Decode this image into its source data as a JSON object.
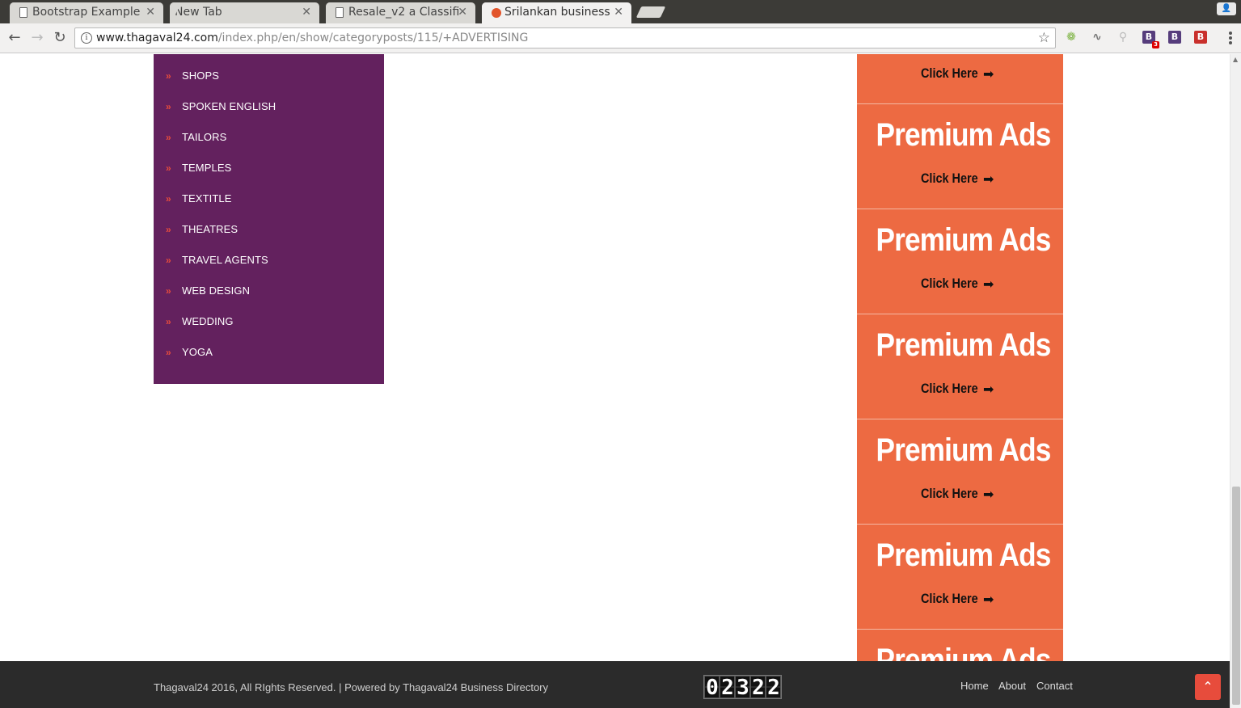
{
  "browser": {
    "tabs": [
      {
        "title": "Bootstrap Example"
      },
      {
        "title": "New Tab"
      },
      {
        "title": "Resale_v2 a Classifi"
      },
      {
        "title": "Srilankan business"
      }
    ],
    "url_host": "www.thagaval24.com",
    "url_path": "/index.php/en/show/categoryposts/115/+ADVERTISING",
    "extensions": [
      {
        "icon": "fruit-extension-icon",
        "glyph": "❁",
        "color": "#7cb342"
      },
      {
        "icon": "wand-extension-icon",
        "glyph": "∿",
        "color": "#777777"
      },
      {
        "icon": "wrench-extension-icon",
        "glyph": "⚲",
        "color": "#bbbbbb"
      },
      {
        "icon": "bootstrap-extension-icon",
        "glyph": "B",
        "color": "#563d7c",
        "badge": "3"
      },
      {
        "icon": "bootstrap-extension-icon",
        "glyph": "B",
        "color": "#563d7c"
      },
      {
        "icon": "brave-extension-icon",
        "glyph": "B",
        "color": "#c9302c"
      }
    ]
  },
  "sidebar": {
    "chevron": "»",
    "categories": [
      "SHOPS",
      "SPOKEN ENGLISH",
      "TAILORS",
      "TEMPLES",
      "TEXTITLE",
      "THEATRES",
      "TRAVEL AGENTS",
      "WEB DESIGN",
      "WEDDING",
      "YOGA"
    ]
  },
  "ads": {
    "title": "Premium Ads",
    "cta": "Click Here",
    "arrow": "➡",
    "count": 7,
    "color": "#ed6a42"
  },
  "footer": {
    "copyright": "Thagaval24 2016, All RIghts Reserved. | Powered by Thagaval24 Business Directory",
    "counter_digits": [
      "0",
      "2",
      "3",
      "2",
      "2"
    ],
    "nav": [
      "Home",
      "About",
      "Contact"
    ],
    "back_to_top_glyph": "⌃"
  }
}
